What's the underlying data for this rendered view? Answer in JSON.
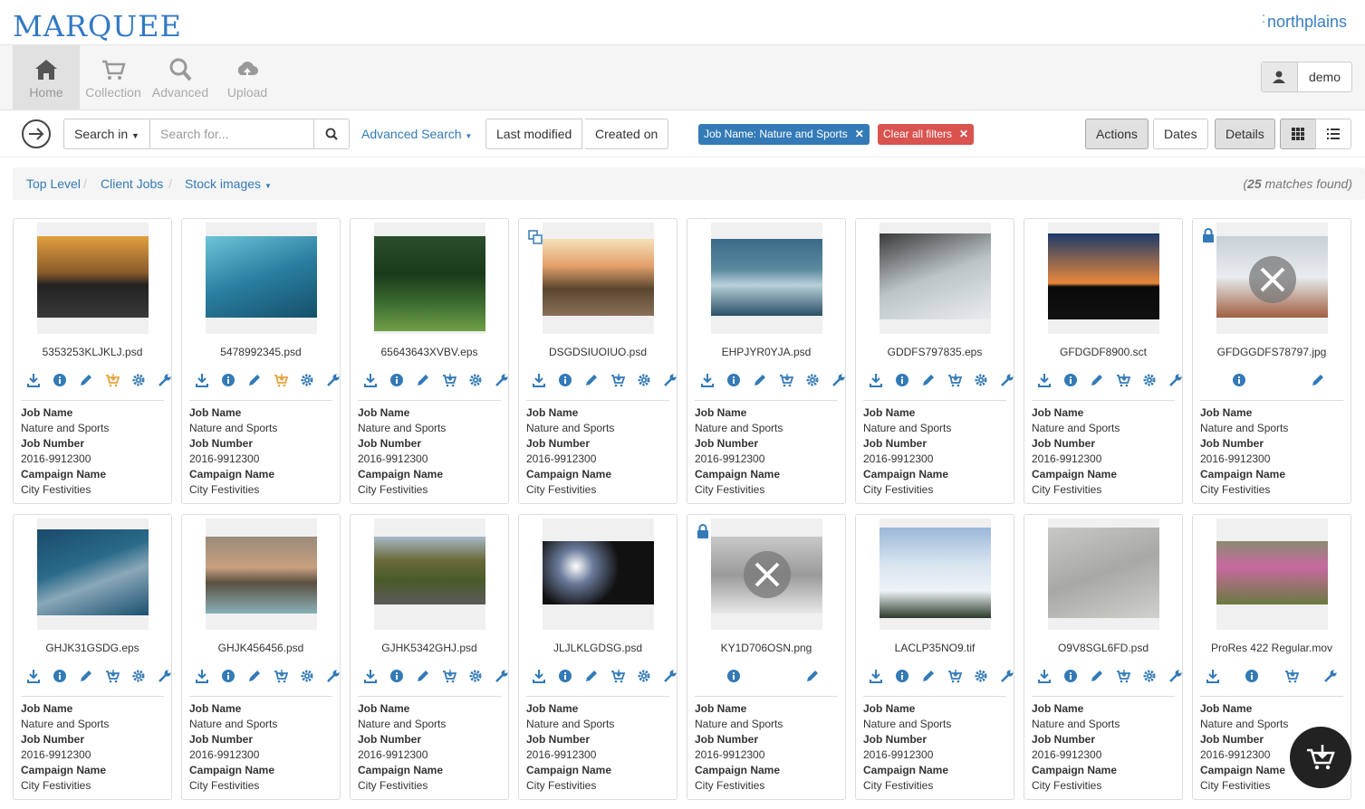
{
  "app": {
    "logo": "MARQUEE",
    "brand": "northplains"
  },
  "nav": [
    {
      "label": "Home",
      "icon": "home-icon"
    },
    {
      "label": "Collection",
      "icon": "cart-icon"
    },
    {
      "label": "Advanced",
      "icon": "search-icon"
    },
    {
      "label": "Upload",
      "icon": "upload-icon"
    }
  ],
  "user": {
    "name": "demo"
  },
  "toolbar": {
    "search_in": "Search in",
    "search_placeholder": "Search for...",
    "advanced_search": "Advanced Search",
    "last_modified": "Last modified",
    "created_on": "Created on",
    "filter_job": "Job Name: Nature and Sports",
    "clear_filters": "Clear all filters",
    "actions": "Actions",
    "dates": "Dates",
    "details": "Details"
  },
  "breadcrumb": {
    "items": [
      "Top Level",
      "Client Jobs",
      "Stock images"
    ],
    "matches_count": "25",
    "matches_suffix": " matches found)",
    "matches_prefix": "("
  },
  "meta_labels": {
    "job_name": "Job Name",
    "job_number": "Job Number",
    "campaign_name": "Campaign Name"
  },
  "assets": [
    {
      "file": "5353253KLJKLJ.psd",
      "job_name": "Nature and Sports",
      "job_number": "2016-9912300",
      "campaign": "City Festivities"
    },
    {
      "file": "5478992345.psd",
      "job_name": "Nature and Sports",
      "job_number": "2016-9912300",
      "campaign": "City Festivities"
    },
    {
      "file": "65643643XVBV.eps",
      "job_name": "Nature and Sports",
      "job_number": "2016-9912300",
      "campaign": "City Festivities"
    },
    {
      "file": "DSGDSIUOIUO.psd",
      "job_name": "Nature and Sports",
      "job_number": "2016-9912300",
      "campaign": "City Festivities"
    },
    {
      "file": "EHPJYR0YJA.psd",
      "job_name": "Nature and Sports",
      "job_number": "2016-9912300",
      "campaign": "City Festivities"
    },
    {
      "file": "GDDFS797835.eps",
      "job_name": "Nature and Sports",
      "job_number": "2016-9912300",
      "campaign": "City Festivities"
    },
    {
      "file": "GFDGDF8900.sct",
      "job_name": "Nature and Sports",
      "job_number": "2016-9912300",
      "campaign": "City Festivities"
    },
    {
      "file": "GFDGGDFS78797.jpg",
      "job_name": "Nature and Sports",
      "job_number": "2016-9912300",
      "campaign": "City Festivities"
    },
    {
      "file": "GHJK31GSDG.eps",
      "job_name": "Nature and Sports",
      "job_number": "2016-9912300",
      "campaign": "City Festivities"
    },
    {
      "file": "GHJK456456.psd",
      "job_name": "Nature and Sports",
      "job_number": "2016-9912300",
      "campaign": "City Festivities"
    },
    {
      "file": "GJHK5342GHJ.psd",
      "job_name": "Nature and Sports",
      "job_number": "2016-9912300",
      "campaign": "City Festivities"
    },
    {
      "file": "JLJLKLGDSG.psd",
      "job_name": "Nature and Sports",
      "job_number": "2016-9912300",
      "campaign": "City Festivities"
    },
    {
      "file": "KY1D706OSN.png",
      "job_name": "Nature and Sports",
      "job_number": "2016-9912300",
      "campaign": "City Festivities"
    },
    {
      "file": "LACLP35NO9.tif",
      "job_name": "Nature and Sports",
      "job_number": "2016-9912300",
      "campaign": "City Festivities"
    },
    {
      "file": "O9V8SGL6FD.psd",
      "job_name": "Nature and Sports",
      "job_number": "2016-9912300",
      "campaign": "City Festivities"
    },
    {
      "file": "ProRes 422 Regular.mov",
      "job_name": "Nature and Sports",
      "job_number": "2016-9912300",
      "campaign": "City Festivities"
    }
  ],
  "colors": {
    "accent": "#337ab7",
    "danger": "#d9534f",
    "highlight": "#e6a23c"
  }
}
